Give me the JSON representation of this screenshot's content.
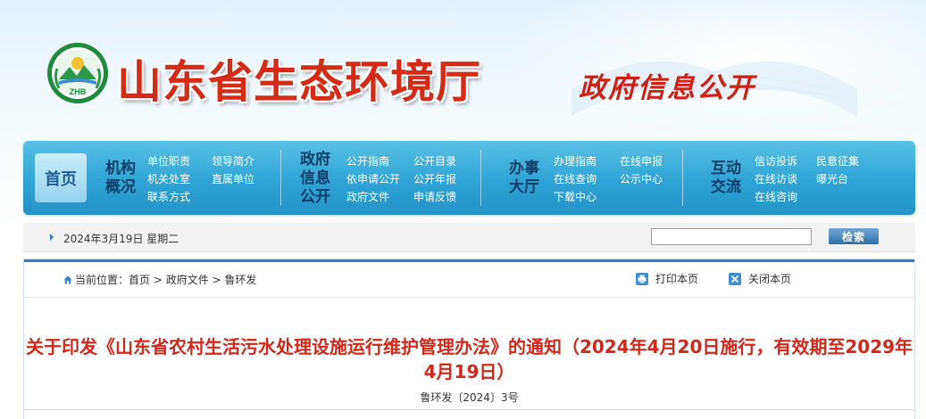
{
  "header": {
    "site_title": "山东省生态环境厅",
    "emblem_text": "ZHB",
    "section_title": "政府信息公开"
  },
  "nav": {
    "home": "首页",
    "groups": [
      {
        "title_lines": [
          "机构",
          "概况"
        ],
        "links": [
          "单位职责",
          "领导简介",
          "机关处室",
          "直属单位",
          "联系方式"
        ]
      },
      {
        "title_lines": [
          "政府",
          "信息",
          "公开"
        ],
        "links": [
          "公开指南",
          "公开目录",
          "依申请公开",
          "公开年报",
          "政府文件",
          "申请反馈"
        ]
      },
      {
        "title_lines": [
          "办事",
          "大厅"
        ],
        "links": [
          "办理指南",
          "在线申报",
          "在线查询",
          "公示中心",
          "下载中心"
        ]
      },
      {
        "title_lines": [
          "互动",
          "交流"
        ],
        "links": [
          "信访投诉",
          "民意征集",
          "在线访谈",
          "曝光台",
          "在线咨询"
        ]
      }
    ]
  },
  "datebar": {
    "date": "2024年3月19日 星期二",
    "search_value": "",
    "search_button": "检索"
  },
  "breadcrumb": {
    "prefix": "当前位置：",
    "items": [
      "首页",
      "政府文件",
      "鲁环发"
    ],
    "separator": " > "
  },
  "tools": {
    "print": "打印本页",
    "close": "关闭本页"
  },
  "document": {
    "title": "关于印发《山东省农村生活污水处理设施运行维护管理办法》的通知（2024年4月20日施行，有效期至2029年4月19日）",
    "number": "鲁环发〔2024〕3号"
  },
  "colors": {
    "title_red": "#d42a16",
    "nav_blue": "#2fa3d4",
    "nav_group_title": "#0d3e6a",
    "accent_blue": "#2d7ec4"
  }
}
